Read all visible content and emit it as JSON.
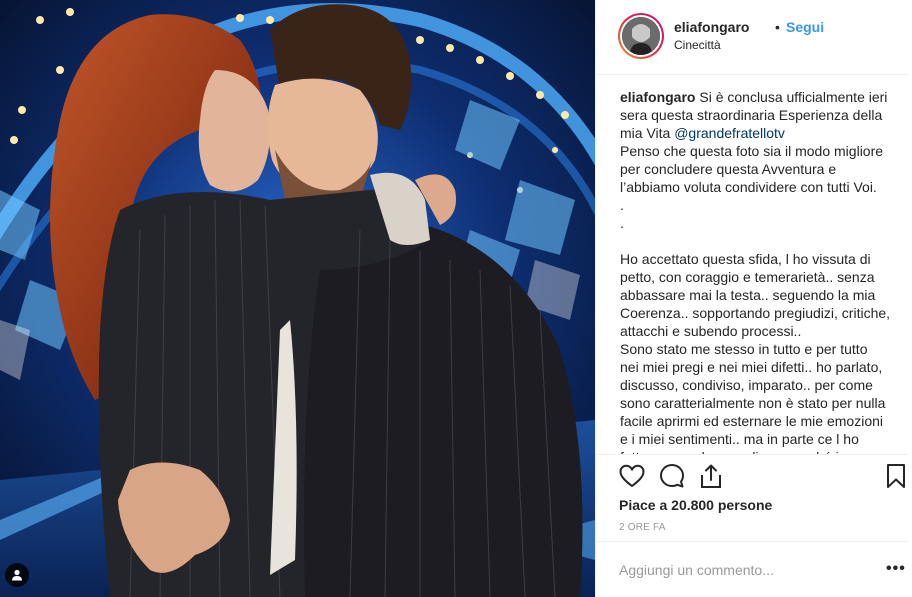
{
  "post": {
    "username": "eliafongaro",
    "separator": "•",
    "follow_label": "Segui",
    "location": "Cinecittà"
  },
  "caption": {
    "lines": [
      {
        "prefix": "eliafongaro",
        "text": " Si è conclusa ufficialmente ieri"
      },
      {
        "text": "sera questa straordinaria Esperienza della"
      },
      {
        "text": "mia Vita ",
        "mention": "@grandefratellotv"
      },
      {
        "text": "Penso che questa foto sia il modo migliore"
      },
      {
        "text": "per concludere questa Avventura e"
      },
      {
        "text": "l’abbiamo voluta condividere con tutti Voi."
      },
      {
        "text": "."
      },
      {
        "text": "."
      },
      {
        "text": ""
      },
      {
        "text": "Ho accettato questa sfida, l ho vissuta di"
      },
      {
        "text": "petto, con coraggio e temerarietà.. senza"
      },
      {
        "text": "abbassare mai la testa.. seguendo la mia"
      },
      {
        "text": "Coerenza.. sopportando pregiudizi, critiche,"
      },
      {
        "text": "attacchi e subendo processi.."
      },
      {
        "text": "Sono stato me stesso in tutto e per tutto"
      },
      {
        "text": "nei miei pregi e nei miei difetti.. ho parlato,"
      },
      {
        "text": "discusso, condiviso, imparato.. per come"
      },
      {
        "text": "sono caratterialmente non è stato per nulla"
      },
      {
        "text": "facile aprirmi ed esternare le mie emozioni"
      },
      {
        "text": "e i miei sentimenti.. ma in parte ce l ho"
      },
      {
        "text": "fatto e ne vado orgoglioso, perché in"
      }
    ]
  },
  "actions": {
    "like_icon": "heart-icon",
    "comment_icon": "comment-icon",
    "share_icon": "share-icon",
    "save_icon": "bookmark-icon",
    "likes_text": "Piace a 20.800 persone",
    "time_text": "2 ORE FA"
  },
  "comment_box": {
    "placeholder": "Aggiungi un commento...",
    "more_label": "•••"
  },
  "colors": {
    "link": "#3897f0",
    "mention": "#003569",
    "text": "#262626",
    "muted": "#999999"
  }
}
